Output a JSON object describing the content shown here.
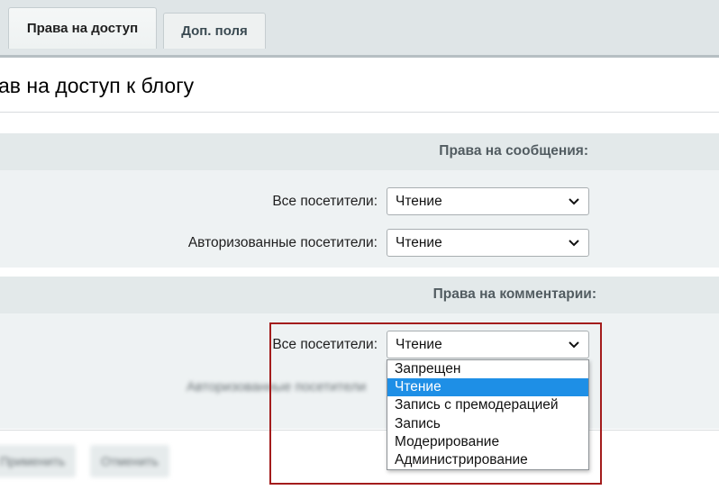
{
  "tabs": [
    {
      "label": "Права на доступ",
      "active": true
    },
    {
      "label": "Доп. поля",
      "active": false
    }
  ],
  "heading": "ав на доступ к блогу",
  "sections": {
    "posts": {
      "title": "Права на сообщения:",
      "rows": [
        {
          "label": "Все посетители:",
          "value": "Чтение"
        },
        {
          "label": "Авторизованные посетители:",
          "value": "Чтение"
        }
      ]
    },
    "comments": {
      "title": "Права на комментарии:",
      "rows": [
        {
          "label": "Все посетители:",
          "value": "Чтение"
        },
        {
          "label": "Авторизованные посетители",
          "value": ""
        }
      ]
    }
  },
  "dropdown": {
    "options": [
      "Запрещен",
      "Чтение",
      "Запись с премодерацией",
      "Запись",
      "Модерирование",
      "Администрирование"
    ],
    "selected": "Чтение"
  },
  "footer": {
    "apply_label": "Применить",
    "cancel_label": "Отменить"
  },
  "colors": {
    "highlight_border": "#a31c1c",
    "selected_option": "#1e8fe6",
    "section_header_bg": "#e3e9ea"
  }
}
